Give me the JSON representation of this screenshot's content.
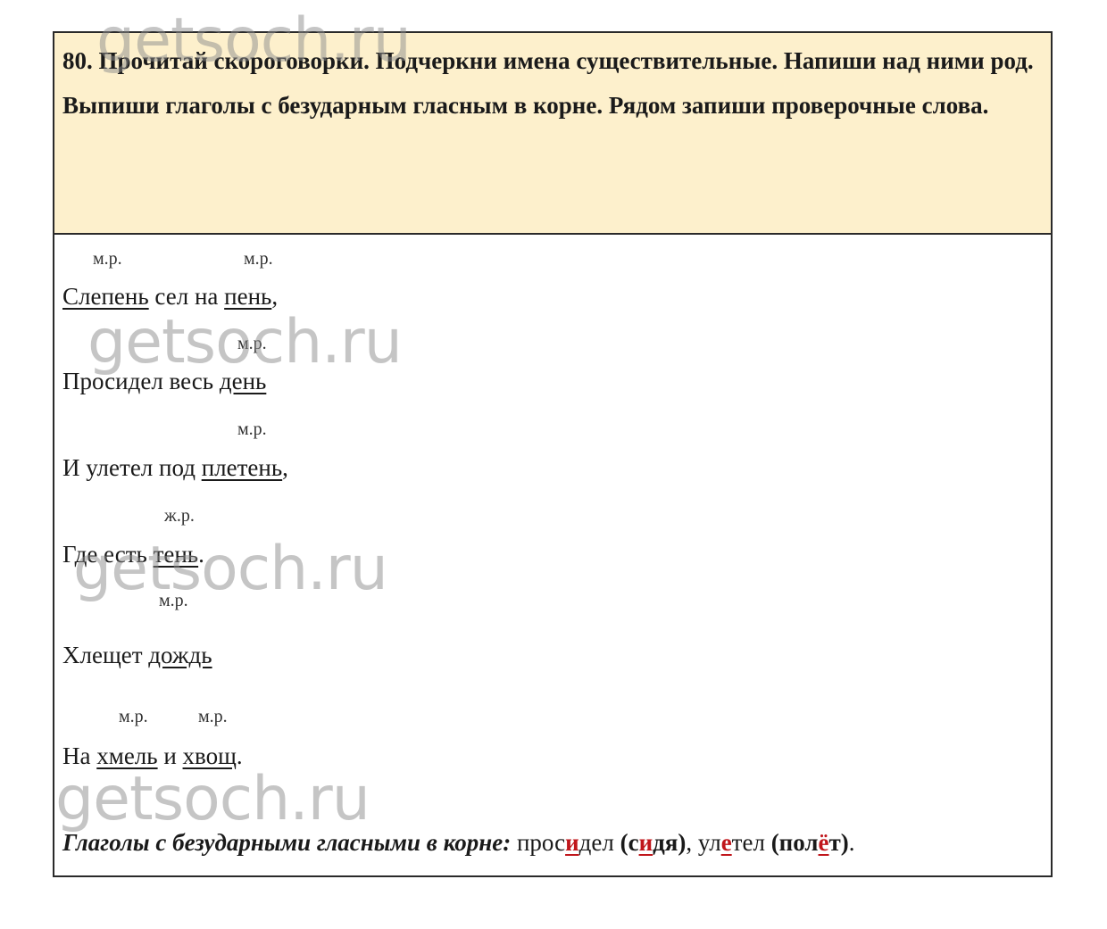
{
  "task": {
    "line1": "80. Прочитай скороговорки. Подчеркни имена существительные. Напиши над ними род.",
    "line2": "Выпиши глаголы с безударным гласным в корне. Рядом запиши проверочные слова."
  },
  "lines": [
    {
      "gender": [
        "м.р.",
        "м.р."
      ],
      "parts": [
        "Слепень",
        " сел на ",
        "пень",
        ","
      ]
    },
    {
      "gender": [
        "м.р."
      ],
      "parts": [
        "Просидел весь ",
        "день"
      ]
    },
    {
      "gender": [
        "м.р."
      ],
      "parts": [
        "И улетел под ",
        "плетень",
        ","
      ]
    },
    {
      "gender": [
        "ж.р."
      ],
      "parts": [
        "Где есть ",
        "тень",
        "."
      ]
    },
    {
      "gender": [
        "м.р."
      ],
      "parts": [
        "Хлещет ",
        "дождь"
      ]
    },
    {
      "gender": [
        "м.р.",
        "м.р."
      ],
      "parts": [
        "На ",
        "хмель",
        " и ",
        "хвощ",
        "."
      ]
    }
  ],
  "verbs": {
    "label": "Глаголы с безударными гласными в корне:",
    "w1": [
      "прос",
      "и",
      "дел"
    ],
    "c1": [
      "(с",
      "и",
      "дя)"
    ],
    "sep": ", ",
    "w2": [
      "ул",
      "е",
      "тел"
    ],
    "c2": [
      "(пол",
      "ё",
      "т)"
    ],
    "end": "."
  },
  "watermark": "getsoch.ru"
}
